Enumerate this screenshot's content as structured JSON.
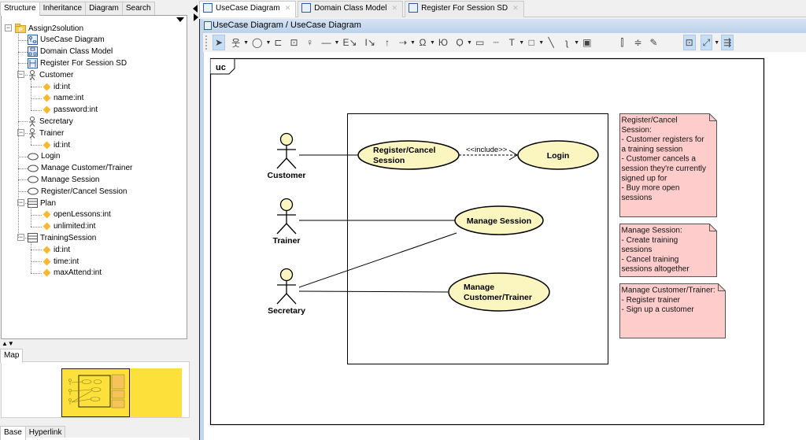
{
  "left_panel": {
    "tabs": [
      "Structure",
      "Inheritance",
      "Diagram",
      "Search"
    ],
    "active_tab": "Structure",
    "tree": [
      {
        "label": "Assign2solution",
        "icon": "project-folder-icon",
        "level": 0,
        "expander": "minus"
      },
      {
        "label": "UseCase Diagram",
        "icon": "usecase-diagram-icon",
        "level": 1
      },
      {
        "label": "Domain Class Model",
        "icon": "class-diagram-icon",
        "level": 1
      },
      {
        "label": "Register For Session SD",
        "icon": "sequence-diagram-icon",
        "level": 1
      },
      {
        "label": "Customer",
        "icon": "actor-icon",
        "level": 1,
        "expander": "minus"
      },
      {
        "label": "id:int",
        "icon": "attribute-icon",
        "level": 2
      },
      {
        "label": "name:int",
        "icon": "attribute-icon",
        "level": 2
      },
      {
        "label": "password:int",
        "icon": "attribute-icon",
        "level": 2
      },
      {
        "label": "Secretary",
        "icon": "actor-icon",
        "level": 1
      },
      {
        "label": "Trainer",
        "icon": "actor-icon",
        "level": 1,
        "expander": "minus"
      },
      {
        "label": "id:int",
        "icon": "attribute-icon",
        "level": 2
      },
      {
        "label": "Login",
        "icon": "usecase-icon",
        "level": 1
      },
      {
        "label": "Manage Customer/Trainer",
        "icon": "usecase-icon",
        "level": 1
      },
      {
        "label": "Manage Session",
        "icon": "usecase-icon",
        "level": 1
      },
      {
        "label": "Register/Cancel Session",
        "icon": "usecase-icon",
        "level": 1
      },
      {
        "label": "Plan",
        "icon": "class-icon",
        "level": 1,
        "expander": "minus"
      },
      {
        "label": "openLessons:int",
        "icon": "attribute-icon",
        "level": 2
      },
      {
        "label": "unlimited:int",
        "icon": "attribute-icon",
        "level": 2
      },
      {
        "label": "TrainingSession",
        "icon": "class-icon",
        "level": 1,
        "expander": "minus"
      },
      {
        "label": "id:int",
        "icon": "attribute-icon",
        "level": 2
      },
      {
        "label": "time:int",
        "icon": "attribute-icon",
        "level": 2
      },
      {
        "label": "maxAttend:int",
        "icon": "attribute-icon",
        "level": 2
      }
    ],
    "map_tab": "Map",
    "bottom_tabs": [
      "Base",
      "Hyperlink"
    ],
    "active_bottom_tab": "Base"
  },
  "editor": {
    "tabs": [
      {
        "label": "UseCase Diagram",
        "icon": "usecase-diagram-icon",
        "active": true
      },
      {
        "label": "Domain Class Model",
        "icon": "class-diagram-icon",
        "active": false
      },
      {
        "label": "Register For Session SD",
        "icon": "sequence-diagram-icon",
        "active": false
      }
    ],
    "breadcrumb": "UseCase Diagram / UseCase Diagram",
    "toolbar": [
      {
        "name": "select-tool",
        "glyph": "➤",
        "selected": true
      },
      {
        "name": "actor-tool",
        "glyph": "웃",
        "dropdown": true
      },
      {
        "name": "usecase-tool",
        "glyph": "◯",
        "dropdown": true
      },
      {
        "name": "package-tool",
        "glyph": "⊏"
      },
      {
        "name": "subsystem-tool",
        "glyph": "⊡"
      },
      {
        "name": "pin-tool",
        "glyph": "♀"
      },
      {
        "name": "association-tool",
        "glyph": "—",
        "dropdown": true
      },
      {
        "name": "extend-tool",
        "glyph": "E↘"
      },
      {
        "name": "include-tool",
        "glyph": "I↘"
      },
      {
        "name": "generalization-tool",
        "glyph": "↑"
      },
      {
        "name": "dependency-tool",
        "glyph": "⇢",
        "dropdown": true
      },
      {
        "name": "interface-tool",
        "glyph": "Ω",
        "dropdown": true
      },
      {
        "name": "realization-tool",
        "glyph": "Ю"
      },
      {
        "name": "control-tool",
        "glyph": "Ọ",
        "dropdown": true
      },
      {
        "name": "note-tool",
        "glyph": "▭"
      },
      {
        "name": "anchor-tool",
        "glyph": "┈"
      },
      {
        "name": "text-tool",
        "glyph": "T",
        "dropdown": true
      },
      {
        "name": "rectangle-tool",
        "glyph": "□",
        "dropdown": true
      },
      {
        "name": "line-tool",
        "glyph": "╲"
      },
      {
        "name": "freehand-tool",
        "glyph": "ʅ",
        "dropdown": true
      },
      {
        "name": "image-tool",
        "glyph": "▣"
      },
      {
        "name": "align-vertical-tool",
        "glyph": "⫿",
        "gap": true
      },
      {
        "name": "distribute-tool",
        "glyph": "≑"
      },
      {
        "name": "pin-stick-tool",
        "glyph": "✎"
      },
      {
        "name": "snap-tool",
        "glyph": "⊡",
        "selected": true,
        "gap": true
      },
      {
        "name": "connector-style-tool",
        "glyph": "⤢",
        "selected": true,
        "dropdown": true
      },
      {
        "name": "auto-layout-tool",
        "glyph": "⇶",
        "selected": true
      }
    ]
  },
  "diagram": {
    "frame_label": "uc",
    "actors": [
      {
        "id": "customer",
        "label": "Customer"
      },
      {
        "id": "trainer",
        "label": "Trainer"
      },
      {
        "id": "secretary",
        "label": "Secretary"
      }
    ],
    "usecases": [
      {
        "id": "register",
        "lines": [
          "Register/Cancel",
          "Session"
        ]
      },
      {
        "id": "login",
        "lines": [
          "Login"
        ]
      },
      {
        "id": "manage_session",
        "lines": [
          "Manage Session"
        ]
      },
      {
        "id": "manage_customer",
        "lines": [
          "Manage",
          "Customer/Trainer"
        ]
      }
    ],
    "include_label": "<<include>>",
    "notes": [
      {
        "id": "note-register",
        "lines": [
          "Register/Cancel",
          "Session:",
          "- Customer registers for",
          "a training session",
          "- Customer cancels a",
          "session they're currently",
          "signed up for",
          "- Buy more open",
          "sessions"
        ]
      },
      {
        "id": "note-manage-session",
        "lines": [
          "Manage Session:",
          "- Create training",
          "sessions",
          "- Cancel training",
          "sessions altogether"
        ]
      },
      {
        "id": "note-manage-customer",
        "lines": [
          "Manage Customer/Trainer:",
          "- Register trainer",
          "- Sign up a customer"
        ]
      }
    ],
    "colors": {
      "usecase_fill": "#fbf6c0",
      "actor_head_fill": "#fbf6c0",
      "note_fill": "#ffcccc",
      "map_fill": "#fde13a"
    }
  }
}
